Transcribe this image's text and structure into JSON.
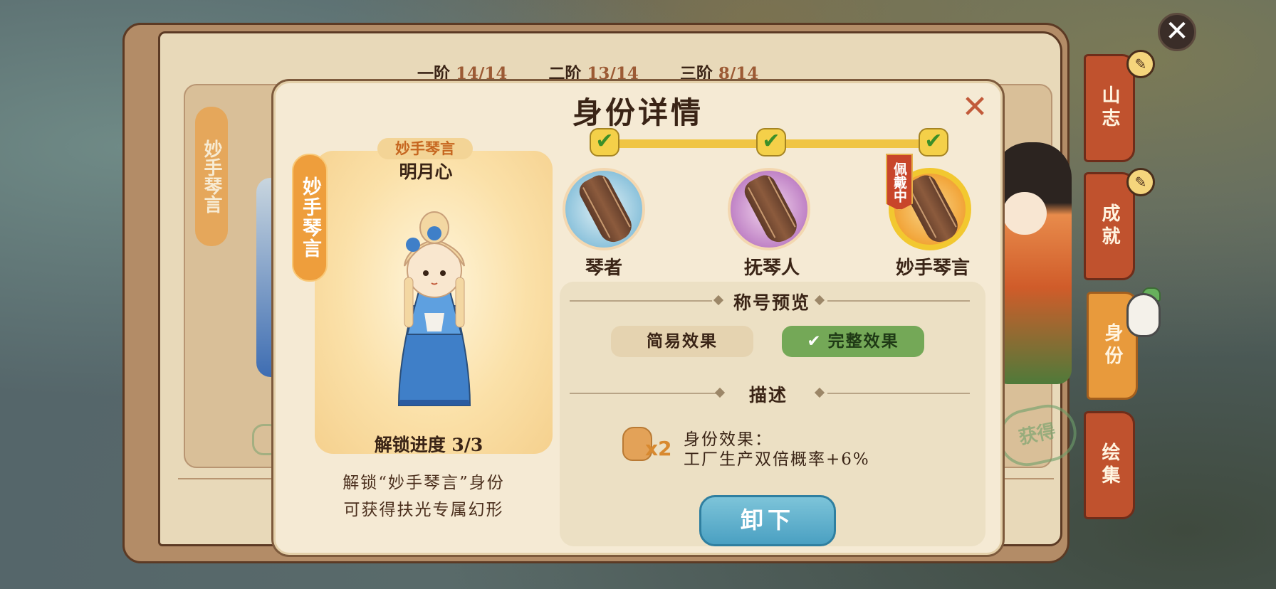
{
  "tiers": [
    {
      "name": "一阶",
      "value": "14/14"
    },
    {
      "name": "二阶",
      "value": "13/14"
    },
    {
      "name": "三阶",
      "value": "8/14"
    }
  ],
  "background": {
    "tag": "妙手琴言",
    "stamp": "获得"
  },
  "side_tabs": [
    {
      "label": "山志"
    },
    {
      "label": "成就"
    },
    {
      "label": "身份"
    },
    {
      "label": "绘集"
    }
  ],
  "dialog": {
    "title": "身份详情",
    "title_tag": "妙手琴言",
    "badge_name": "妙手琴言",
    "char_name": "明月心",
    "progress": "解锁进度 3/3",
    "unlock_desc_1": "解锁“妙手琴言”身份",
    "unlock_desc_2": "可获得扶光专属幻形",
    "tier_items": [
      {
        "label": "琴者",
        "completed": true
      },
      {
        "label": "抚琴人",
        "completed": true
      },
      {
        "label": "妙手琴言",
        "completed": true,
        "equipped": true
      }
    ],
    "equipped_ribbon": "佩戴中",
    "section_preview": "称号预览",
    "option_simple": "简易效果",
    "option_full": "完整效果",
    "selected_option": "完整效果",
    "section_desc": "描述",
    "bag_multiplier": "x2",
    "effect_title": "身份效果：",
    "effect_text": "工厂生产双倍概率+6%",
    "unequip_button": "卸下"
  },
  "icons": {
    "close": "close-icon",
    "check": "check-icon",
    "quill": "quill-icon",
    "bag": "money-bag-icon"
  },
  "colors": {
    "accent_orange": "#ee9e3c",
    "tab_red": "#c0522e",
    "option_green": "#74a857",
    "button_blue": "#4aa0c2",
    "check_yellow": "#f4d049"
  }
}
